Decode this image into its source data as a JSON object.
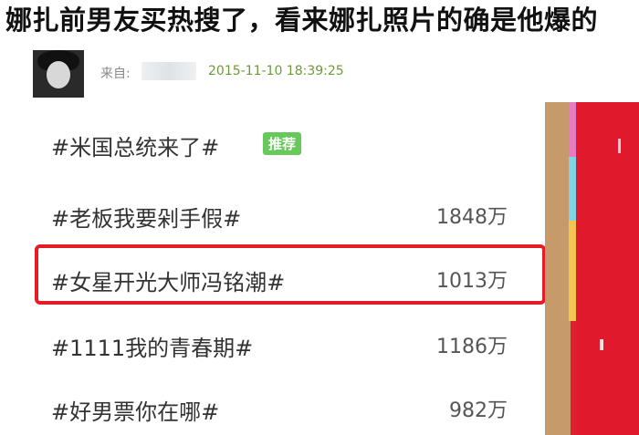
{
  "headline": "娜扎前男友买热搜了，看来娜扎照片的确是他爆的",
  "post": {
    "source_label": "来自:",
    "timestamp": "2015-11-10 18:39:25"
  },
  "hot_list": [
    {
      "topic": "#米国总统来了#",
      "badge": "推荐",
      "count": ""
    },
    {
      "topic": "#老板我要剁手假#",
      "count": "1848万"
    },
    {
      "topic": "#女星开光大师冯铭潮#",
      "count": "1013万"
    },
    {
      "topic": "#1111我的青春期#",
      "count": "1186万"
    },
    {
      "topic": "#好男票你在哪#",
      "count": "982万"
    }
  ]
}
